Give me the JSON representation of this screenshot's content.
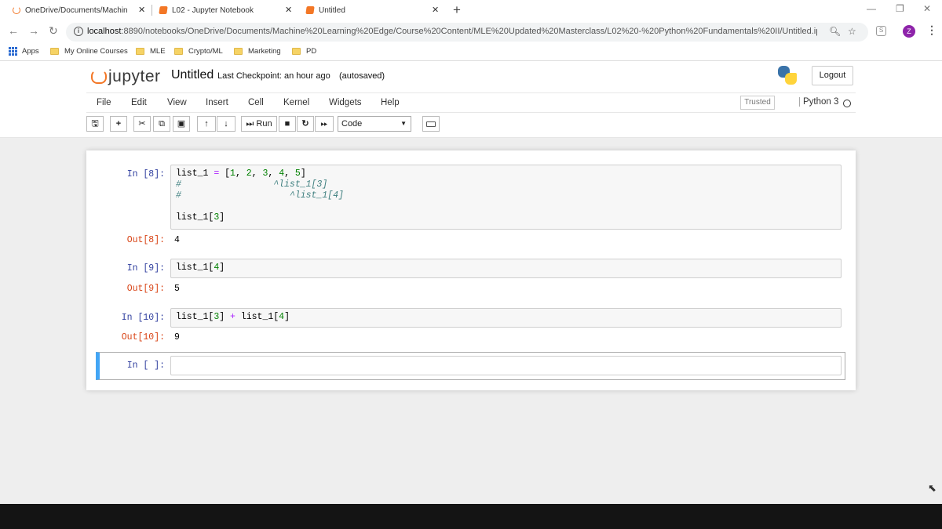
{
  "browser": {
    "tabs": [
      {
        "title": "OneDrive/Documents/Machine L",
        "icon": "jupyter-ring-icon"
      },
      {
        "title": "L02 - Jupyter Notebook",
        "icon": "notebook-icon"
      },
      {
        "title": "Untitled",
        "icon": "notebook-icon"
      }
    ],
    "url_host": "localhost",
    "url_path": ":8890/notebooks/OneDrive/Documents/Machine%20Learning%20Edge/Course%20Content/MLE%20Updated%20Masterclass/L02%20-%20Python%20Fundamentals%20II/Untitled.ipy...",
    "profile_initial": "Z",
    "profile_color": "#8e24aa"
  },
  "bookmarks": [
    {
      "label": "Apps"
    },
    {
      "label": "My Online Courses"
    },
    {
      "label": "MLE"
    },
    {
      "label": "Crypto/ML"
    },
    {
      "label": "Marketing"
    },
    {
      "label": "PD"
    }
  ],
  "jupyter": {
    "logo_text": "jupyter",
    "notebook_name": "Untitled",
    "checkpoint": "Last Checkpoint: an hour ago",
    "autosave": "(autosaved)",
    "logout_label": "Logout",
    "accent": "#f37726",
    "menu": [
      "File",
      "Edit",
      "View",
      "Insert",
      "Cell",
      "Kernel",
      "Widgets",
      "Help"
    ],
    "trusted_label": "Trusted",
    "kernel_name": "Python 3",
    "toolbar": {
      "run_label": "Run",
      "cell_type": "Code"
    }
  },
  "cells": [
    {
      "in_prompt": "In [8]:",
      "out_prompt": "Out[8]:",
      "output": "4"
    },
    {
      "in_prompt": "In [9]:",
      "out_prompt": "Out[9]:",
      "output": "5"
    },
    {
      "in_prompt": "In [10]:",
      "out_prompt": "Out[10]:",
      "output": "9"
    },
    {
      "in_prompt": "In [ ]:"
    }
  ],
  "code": {
    "c8_l1_a": "list_1 ",
    "c8_l1_eq": "=",
    "c8_l1_b": " [",
    "c8_n1": "1",
    "c8_n2": "2",
    "c8_n3": "3",
    "c8_n4": "4",
    "c8_n5": "5",
    "c8_l2": "#                 ^list_1[3]",
    "c8_l3": "#                    ^list_1[4]",
    "c8_l5_a": "list_1[",
    "c8_l5_n": "3",
    "c9_a": "list_1[",
    "c9_n": "4",
    "c10_a": "list_1[",
    "c10_n1": "3",
    "c10_b": "] ",
    "c10_plus": "+",
    "c10_c": " list_1[",
    "c10_n2": "4"
  }
}
